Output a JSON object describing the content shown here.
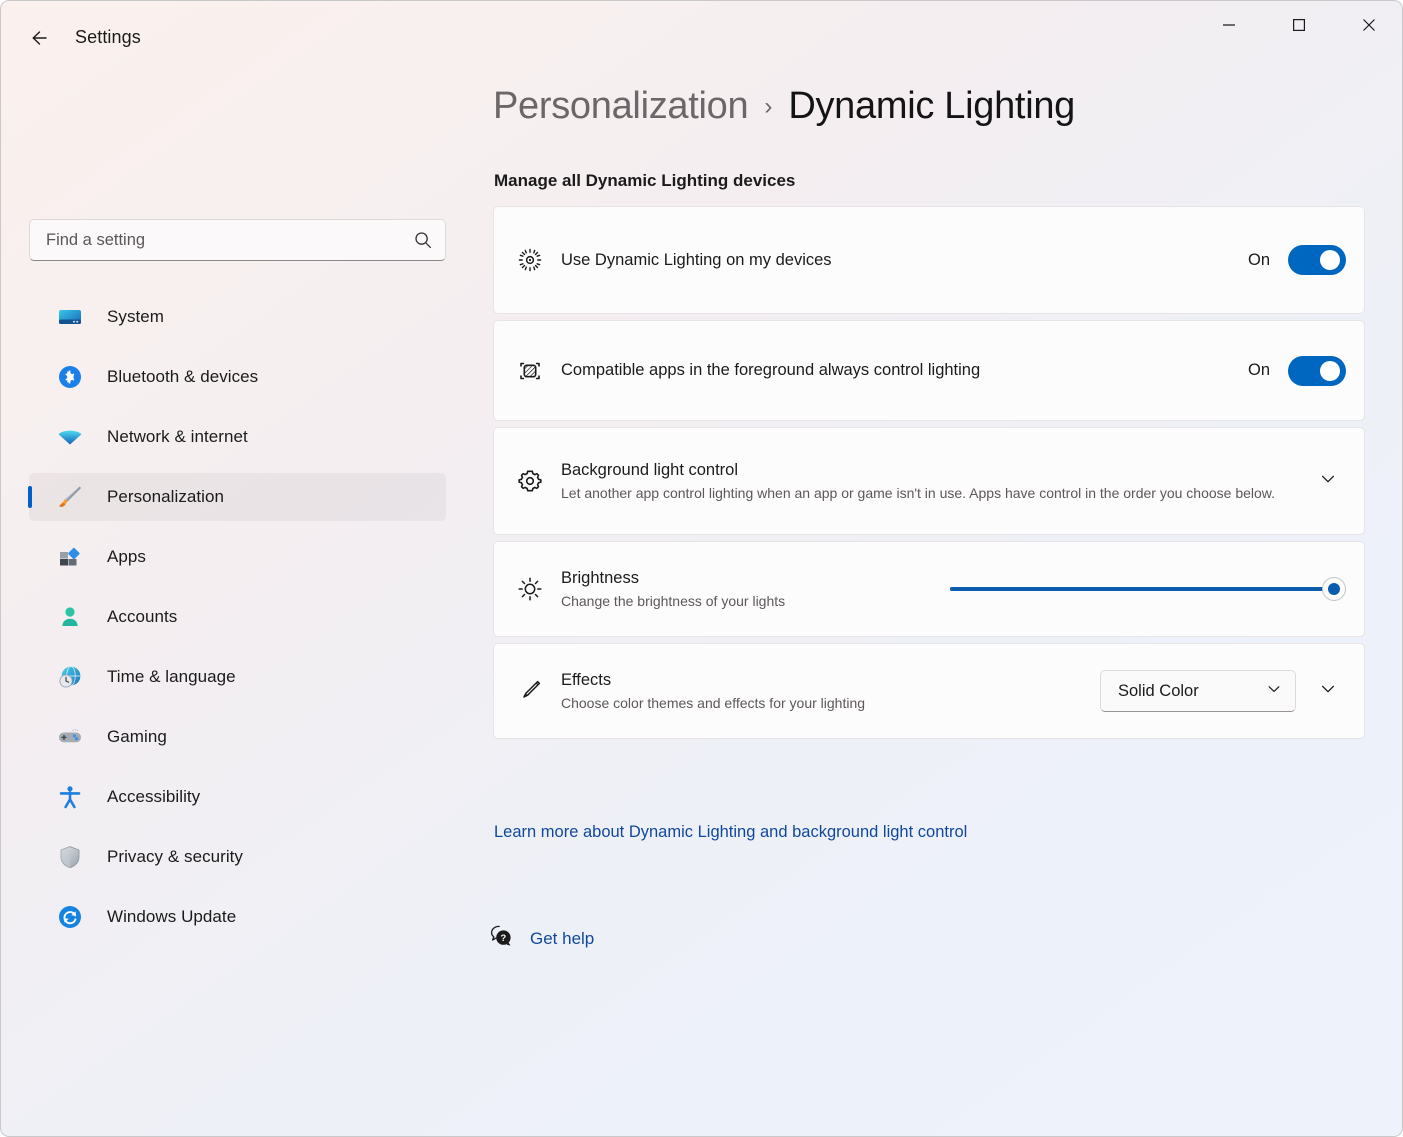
{
  "window": {
    "app_title": "Settings",
    "back_icon": "back-arrow-icon",
    "minimize_label": "Minimize",
    "maximize_label": "Maximize",
    "close_label": "Close"
  },
  "search": {
    "placeholder": "Find a setting",
    "value": "",
    "icon": "search-icon"
  },
  "sidebar": {
    "items": [
      {
        "label": "System",
        "icon": "system-monitor-icon",
        "selected": false
      },
      {
        "label": "Bluetooth & devices",
        "icon": "bluetooth-icon",
        "selected": false
      },
      {
        "label": "Network & internet",
        "icon": "wifi-icon",
        "selected": false
      },
      {
        "label": "Personalization",
        "icon": "paintbrush-icon",
        "selected": true
      },
      {
        "label": "Apps",
        "icon": "apps-squares-icon",
        "selected": false
      },
      {
        "label": "Accounts",
        "icon": "person-icon",
        "selected": false
      },
      {
        "label": "Time & language",
        "icon": "clock-globe-icon",
        "selected": false
      },
      {
        "label": "Gaming",
        "icon": "gamepad-icon",
        "selected": false
      },
      {
        "label": "Accessibility",
        "icon": "accessibility-icon",
        "selected": false
      },
      {
        "label": "Privacy & security",
        "icon": "shield-icon",
        "selected": false
      },
      {
        "label": "Windows Update",
        "icon": "update-refresh-icon",
        "selected": false
      }
    ]
  },
  "header": {
    "breadcrumb_parent": "Personalization",
    "breadcrumb_separator": "›",
    "breadcrumb_current": "Dynamic Lighting",
    "section_title": "Manage all Dynamic Lighting devices"
  },
  "settings": {
    "use_dynamic_lighting": {
      "icon": "light-burst-icon",
      "title": "Use Dynamic Lighting on my devices",
      "state_label": "On",
      "checked": true
    },
    "foreground_control": {
      "icon": "foreground-app-icon",
      "title": "Compatible apps in the foreground always control lighting",
      "state_label": "On",
      "checked": true
    },
    "background_light_control": {
      "icon": "gear-icon",
      "title": "Background light control",
      "subtitle": "Let another app control lighting when an app or game isn't in use. Apps have control in the order you choose below.",
      "expander_icon": "chevron-down-icon"
    },
    "brightness": {
      "icon": "sun-icon",
      "title": "Brightness",
      "subtitle": "Change the brightness of your lights",
      "value": 100,
      "min": 0,
      "max": 100
    },
    "effects": {
      "icon": "paintbrush-outline-icon",
      "title": "Effects",
      "subtitle": "Choose color themes and effects for your lighting",
      "selected_option": "Solid Color",
      "dropdown_icon": "chevron-down-icon",
      "expander_icon": "chevron-down-icon"
    }
  },
  "footer": {
    "learn_more": "Learn more about Dynamic Lighting and background light control",
    "get_help_label": "Get help",
    "get_help_icon": "help-question-bubble-icon"
  },
  "colors": {
    "accent": "#0067c0",
    "link": "#10489c",
    "selection_bar": "#0060ca",
    "slider_fill": "#0b5cad"
  }
}
